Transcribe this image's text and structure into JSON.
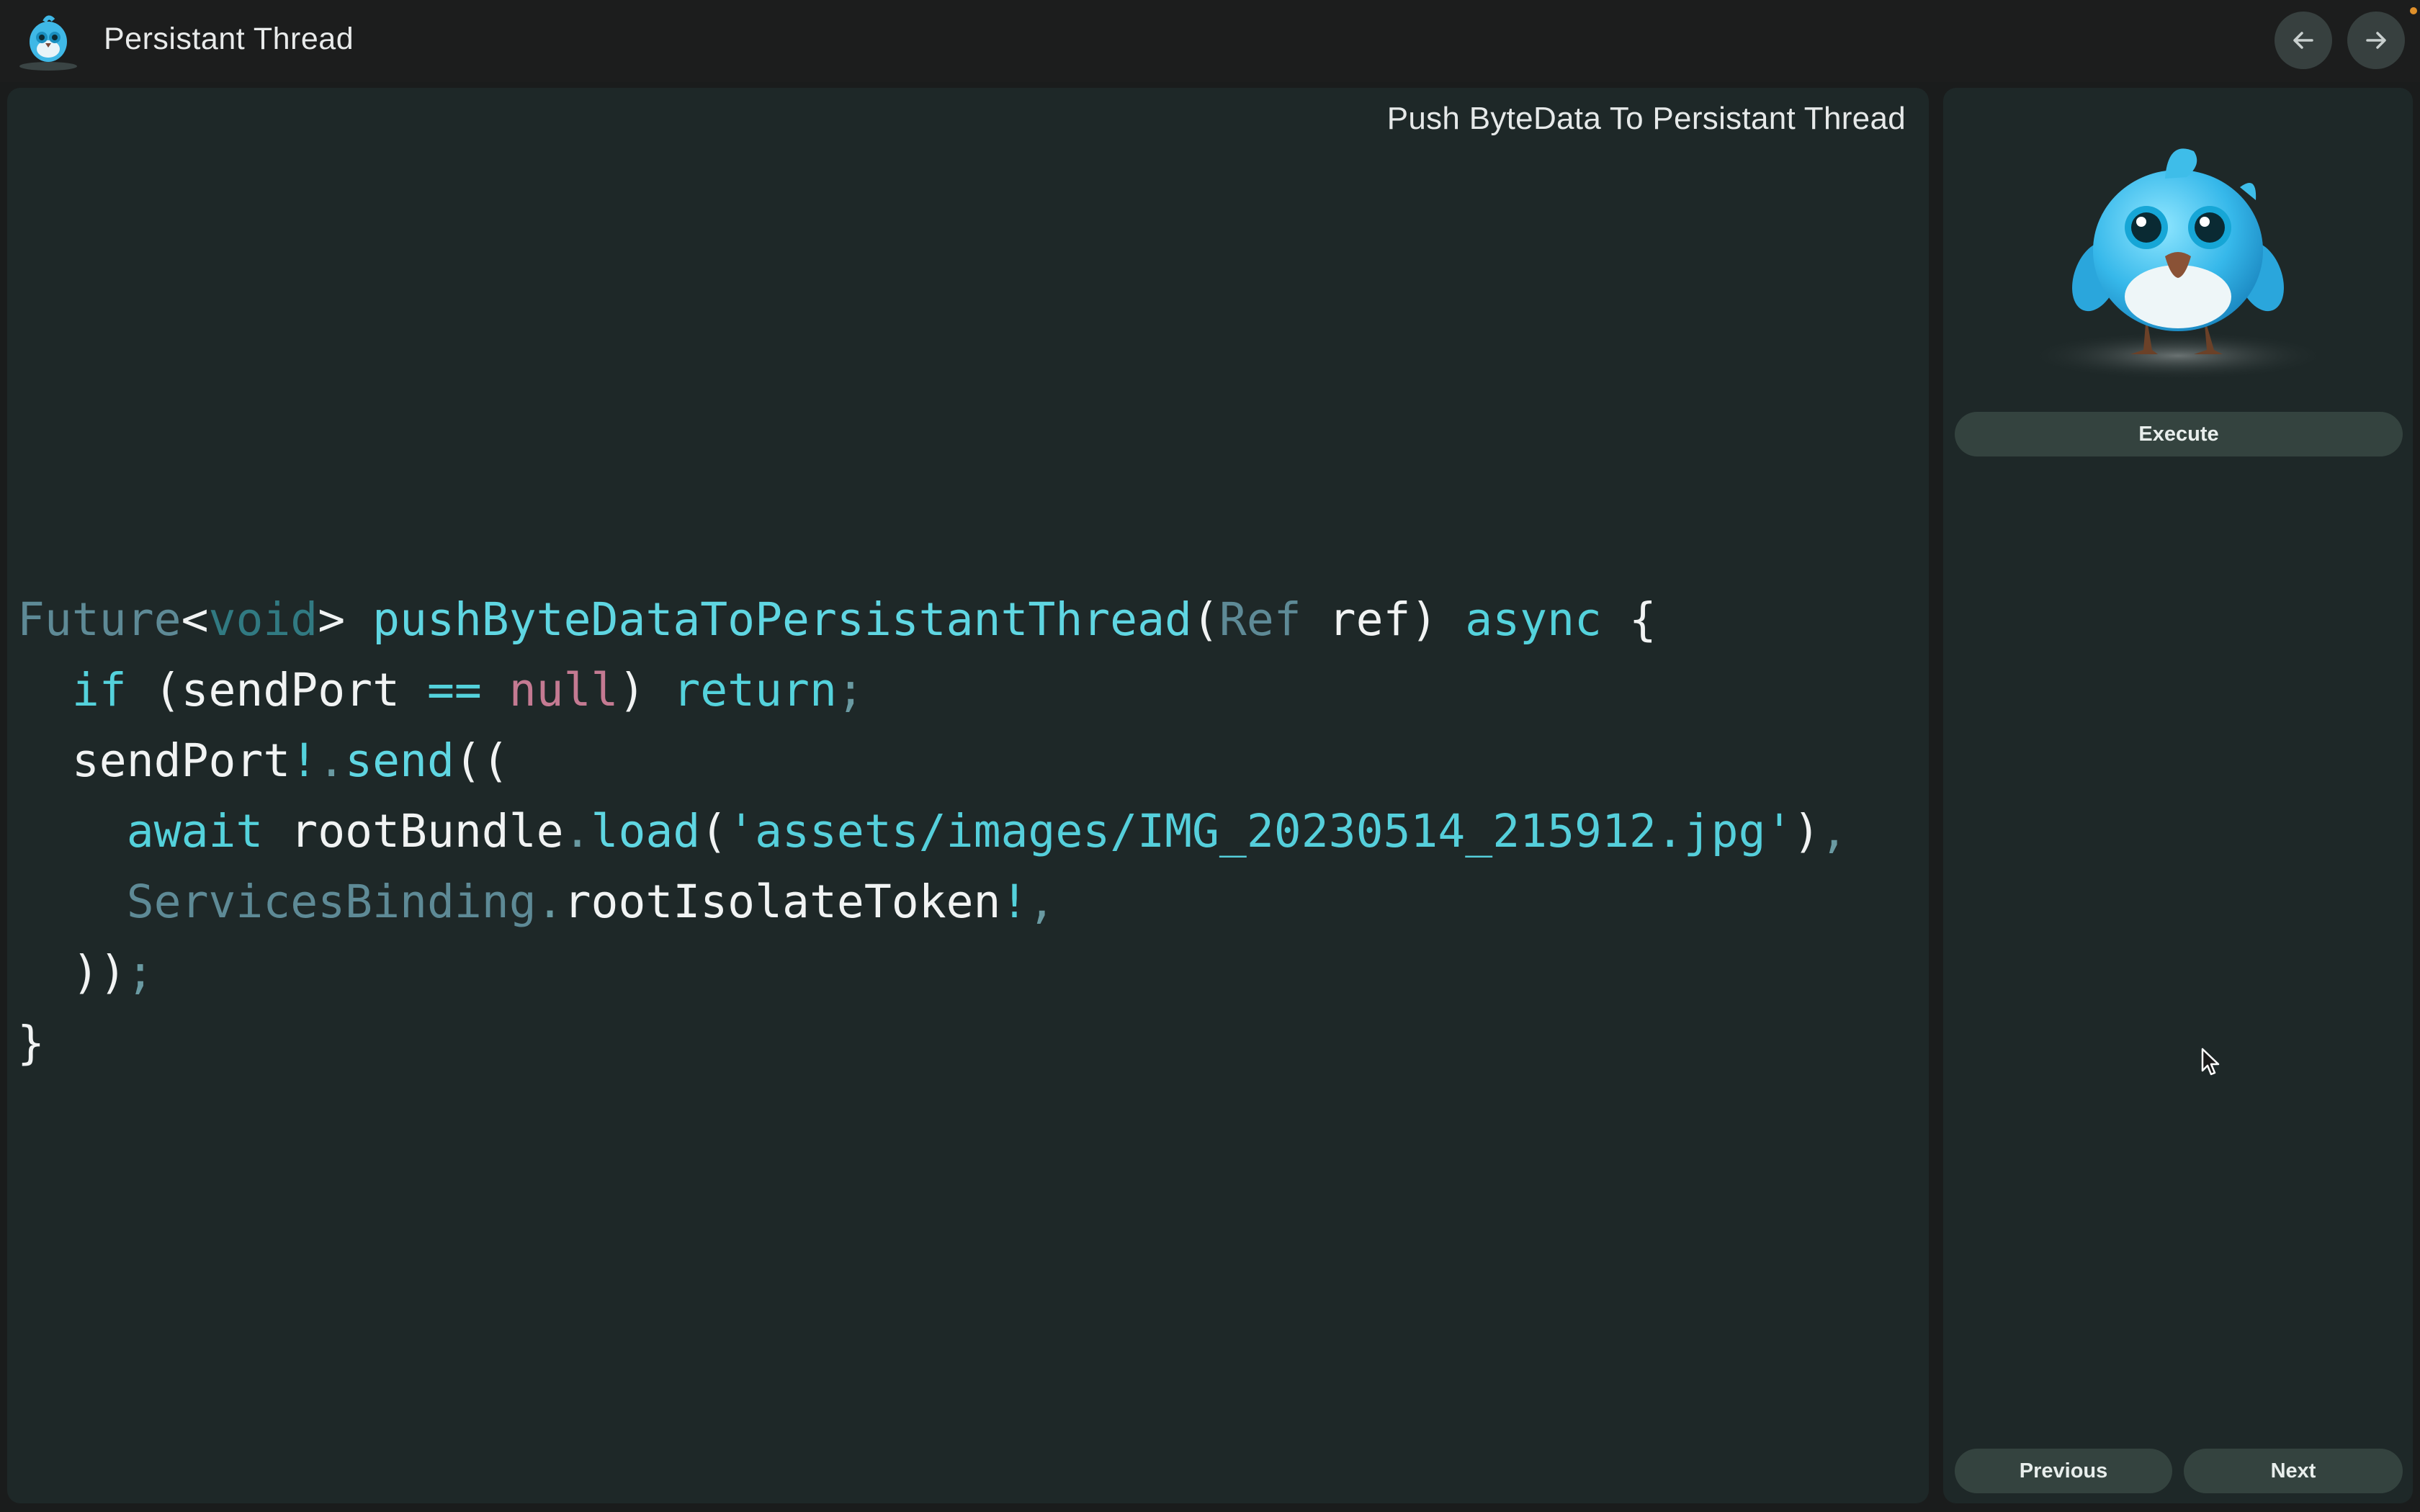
{
  "window": {
    "title": "Persistant Thread",
    "logo_icon": "bird-mascot-icon"
  },
  "toolbar": {
    "back_icon": "arrow-left-icon",
    "forward_icon": "arrow-right-icon"
  },
  "code_panel": {
    "title": "Push ByteData To Persistant Thread",
    "code_lines": [
      [
        {
          "t": "Future",
          "c": "type"
        },
        {
          "t": "<",
          "c": "plain"
        },
        {
          "t": "void",
          "c": "void"
        },
        {
          "t": "> ",
          "c": "plain"
        },
        {
          "t": "pushByteDataToPersistantThread",
          "c": "fn"
        },
        {
          "t": "(",
          "c": "plain"
        },
        {
          "t": "Ref",
          "c": "type"
        },
        {
          "t": " ref) ",
          "c": "plain"
        },
        {
          "t": "async",
          "c": "kw"
        },
        {
          "t": " {",
          "c": "plain"
        }
      ],
      [
        {
          "t": "  ",
          "c": "plain"
        },
        {
          "t": "if",
          "c": "kw"
        },
        {
          "t": " (sendPort ",
          "c": "plain"
        },
        {
          "t": "==",
          "c": "kw"
        },
        {
          "t": " ",
          "c": "plain"
        },
        {
          "t": "null",
          "c": "null"
        },
        {
          "t": ") ",
          "c": "plain"
        },
        {
          "t": "return",
          "c": "kw"
        },
        {
          "t": ";",
          "c": "punct"
        }
      ],
      [
        {
          "t": "  sendPort",
          "c": "plain"
        },
        {
          "t": "!",
          "c": "kw"
        },
        {
          "t": ".",
          "c": "punct"
        },
        {
          "t": "send",
          "c": "fn"
        },
        {
          "t": "((",
          "c": "plain"
        }
      ],
      [
        {
          "t": "    ",
          "c": "plain"
        },
        {
          "t": "await",
          "c": "kw"
        },
        {
          "t": " rootBundle",
          "c": "plain"
        },
        {
          "t": ".",
          "c": "punct"
        },
        {
          "t": "load",
          "c": "fn"
        },
        {
          "t": "(",
          "c": "plain"
        },
        {
          "t": "'assets/images/IMG_20230514_215912.jpg'",
          "c": "str"
        },
        {
          "t": ")",
          "c": "plain"
        },
        {
          "t": ",",
          "c": "punct"
        }
      ],
      [
        {
          "t": "    ",
          "c": "plain"
        },
        {
          "t": "ServicesBinding",
          "c": "type"
        },
        {
          "t": ".",
          "c": "punct"
        },
        {
          "t": "rootIsolateToken",
          "c": "plain"
        },
        {
          "t": "!",
          "c": "kw"
        },
        {
          "t": ",",
          "c": "punct"
        }
      ],
      [
        {
          "t": "  ))",
          "c": "plain"
        },
        {
          "t": ";",
          "c": "punct"
        }
      ],
      [
        {
          "t": "}",
          "c": "plain"
        }
      ]
    ]
  },
  "side_panel": {
    "mascot_icon": "bird-mascot-icon",
    "execute_label": "Execute",
    "previous_label": "Previous",
    "next_label": "Next"
  }
}
